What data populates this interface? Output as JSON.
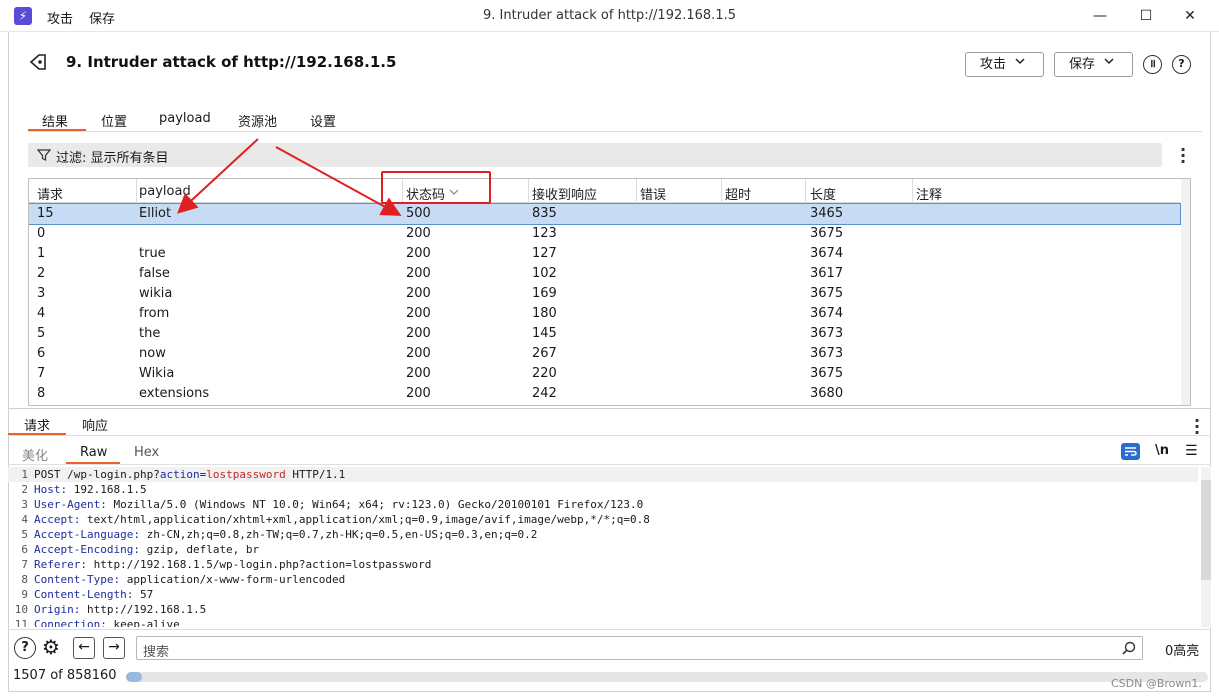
{
  "window": {
    "title": "9. Intruder attack of http://192.168.1.5",
    "menu": [
      "攻击",
      "保存"
    ],
    "app_icon": "bolt-icon"
  },
  "header": {
    "title": "9. Intruder attack of http://192.168.1.5",
    "attack_button": "攻击",
    "save_button": "保存"
  },
  "tabs": [
    "结果",
    "位置",
    "payload",
    "资源池",
    "设置"
  ],
  "filter": {
    "label": "过滤: 显示所有条目"
  },
  "results": {
    "columns": [
      "请求",
      "payload",
      "状态码",
      "接收到响应",
      "错误",
      "超时",
      "长度",
      "注释"
    ],
    "rows": [
      [
        "15",
        "Elliot",
        "500",
        "835",
        "",
        "",
        "3465",
        ""
      ],
      [
        "0",
        "",
        "200",
        "123",
        "",
        "",
        "3675",
        ""
      ],
      [
        "1",
        "true",
        "200",
        "127",
        "",
        "",
        "3674",
        ""
      ],
      [
        "2",
        "false",
        "200",
        "102",
        "",
        "",
        "3617",
        ""
      ],
      [
        "3",
        "wikia",
        "200",
        "169",
        "",
        "",
        "3675",
        ""
      ],
      [
        "4",
        "from",
        "200",
        "180",
        "",
        "",
        "3674",
        ""
      ],
      [
        "5",
        "the",
        "200",
        "145",
        "",
        "",
        "3673",
        ""
      ],
      [
        "6",
        "now",
        "200",
        "267",
        "",
        "",
        "3673",
        ""
      ],
      [
        "7",
        "Wikia",
        "200",
        "220",
        "",
        "",
        "3675",
        ""
      ],
      [
        "8",
        "extensions",
        "200",
        "242",
        "",
        "",
        "3680",
        ""
      ]
    ],
    "selected_request": "15",
    "sort_column": "状态码"
  },
  "panel_tabs": [
    "请求",
    "响应"
  ],
  "view_tabs": [
    "美化",
    "Raw",
    "Hex"
  ],
  "newline_toggle": "\\n",
  "request_lines": [
    {
      "n": "1",
      "key": "",
      "text": "POST /wp-login.php?",
      "param": "action",
      "eq": "=",
      "val": "lostpassword",
      "tail": " HTTP/1.1"
    },
    {
      "n": "2",
      "key": "Host:",
      "text": " 192.168.1.5"
    },
    {
      "n": "3",
      "key": "User-Agent:",
      "text": " Mozilla/5.0 (Windows NT 10.0; Win64; x64; rv:123.0) Gecko/20100101 Firefox/123.0"
    },
    {
      "n": "4",
      "key": "Accept:",
      "text": " text/html,application/xhtml+xml,application/xml;q=0.9,image/avif,image/webp,*/*;q=0.8"
    },
    {
      "n": "5",
      "key": "Accept-Language:",
      "text": " zh-CN,zh;q=0.8,zh-TW;q=0.7,zh-HK;q=0.5,en-US;q=0.3,en;q=0.2"
    },
    {
      "n": "6",
      "key": "Accept-Encoding:",
      "text": " gzip, deflate, br"
    },
    {
      "n": "7",
      "key": "Referer:",
      "text": " http://192.168.1.5/wp-login.php?action=lostpassword"
    },
    {
      "n": "8",
      "key": "Content-Type:",
      "text": " application/x-www-form-urlencoded"
    },
    {
      "n": "9",
      "key": "Content-Length:",
      "text": " 57"
    },
    {
      "n": "10",
      "key": "Origin:",
      "text": " http://192.168.1.5"
    },
    {
      "n": "11",
      "key": "Connection:",
      "text": " keep-alive"
    }
  ],
  "search": {
    "placeholder": "搜索",
    "highlight_count": "0高亮"
  },
  "status": {
    "progress_text": "1507 of 858160",
    "progress_fraction": 0.0018
  },
  "watermark": "CSDN @Brown1.",
  "colors": {
    "accent": "#e8632b",
    "selected_row": "#c7dcf4",
    "annotation_red": "#e02020",
    "header_key": "#1d2d9e"
  }
}
